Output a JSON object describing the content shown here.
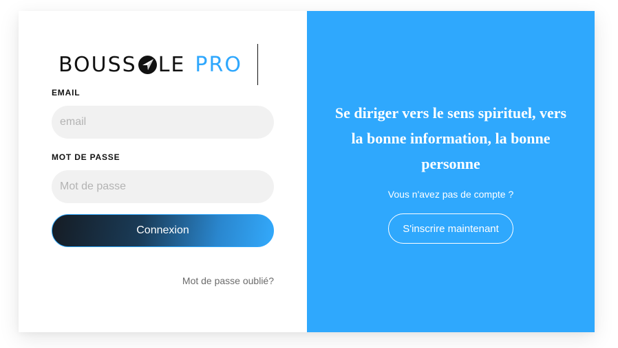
{
  "colors": {
    "accent": "#2ea7fd",
    "panel_bg": "#2fa8fd",
    "input_bg": "#f1f1f1",
    "dark": "#111111"
  },
  "logo": {
    "word_part1": "BOUSS",
    "word_part2": "LE",
    "word_accent": "PRO",
    "icon": "compass-icon"
  },
  "login_form": {
    "email_label": "EMAIL",
    "email_placeholder": "email",
    "email_value": "",
    "password_label": "MOT DE PASSE",
    "password_placeholder": "Mot de passe",
    "password_value": "",
    "submit_label": "Connexion",
    "forgot_label": "Mot de passe oublié?"
  },
  "signup_panel": {
    "tagline": "Se diriger vers le sens spirituel, vers la bonne information, la bonne personne",
    "prompt": "Vous n'avez pas de compte ?",
    "button_label": "S'inscrire maintenant"
  }
}
